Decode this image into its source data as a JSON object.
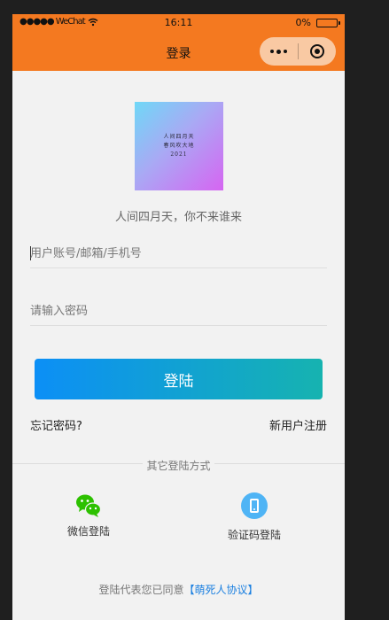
{
  "status_bar": {
    "carrier": "●●●●● WeChat",
    "time": "16:11",
    "battery_percent": "0%"
  },
  "nav": {
    "title": "登录"
  },
  "avatar": {
    "lines": [
      "人间四月天",
      "春风吹大地",
      "2021"
    ]
  },
  "slogan": "人间四月天，你不来谁来",
  "form": {
    "account_placeholder": "用户账号/邮箱/手机号",
    "password_placeholder": "请输入密码",
    "login_label": "登陆"
  },
  "links": {
    "forgot": "忘记密码?",
    "register": "新用户注册"
  },
  "other_login": {
    "title": "其它登陆方式",
    "wechat_label": "微信登陆",
    "code_label": "验证码登陆"
  },
  "agreement": {
    "prefix": "登陆代表您已同意",
    "protocol": "【萌死人协议】"
  },
  "colors": {
    "nav_bg": "#f47920",
    "btn_start": "#0c8ff6",
    "btn_end": "#16b3b0",
    "link_blue": "#1a7fe0"
  }
}
